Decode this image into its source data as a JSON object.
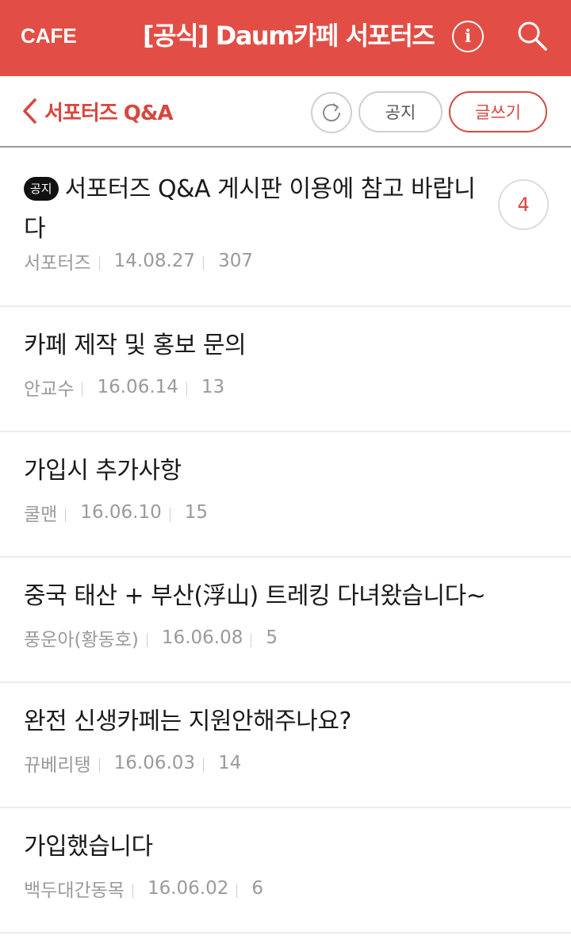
{
  "header": {
    "logo": "CAFE",
    "title": "[공식] Daum카페 서포터즈",
    "info_icon": "info-icon",
    "search_icon": "search-icon",
    "bg_color": "#e24e45"
  },
  "subheader": {
    "back_label": "서포터즈 Q&A",
    "notice_button": "공지",
    "write_button": "글쓰기",
    "accent_color": "#d8473e"
  },
  "posts": [
    {
      "badge": "공지",
      "title": "서포터즈 Q&A 게시판 이용에 참고 바랍니다",
      "author": "서포터즈",
      "date": "14.08.27",
      "views": "307",
      "comments": "4"
    },
    {
      "title": "카페 제작 및 홍보 문의",
      "author": "안교수",
      "date": "16.06.14",
      "views": "13"
    },
    {
      "title": "가입시 추가사항",
      "author": "쿨맨",
      "date": "16.06.10",
      "views": "15"
    },
    {
      "title": "중국 태산 + 부산(浮山) 트레킹 다녀왔습니다~",
      "author": "풍운아(황동호)",
      "date": "16.06.08",
      "views": "5"
    },
    {
      "title": "완전 신생카페는 지원안해주나요?",
      "author": "뀨베리탱",
      "date": "16.06.03",
      "views": "14"
    },
    {
      "title": "가입했습니다",
      "author": "백두대간동목",
      "date": "16.06.02",
      "views": "6"
    }
  ]
}
